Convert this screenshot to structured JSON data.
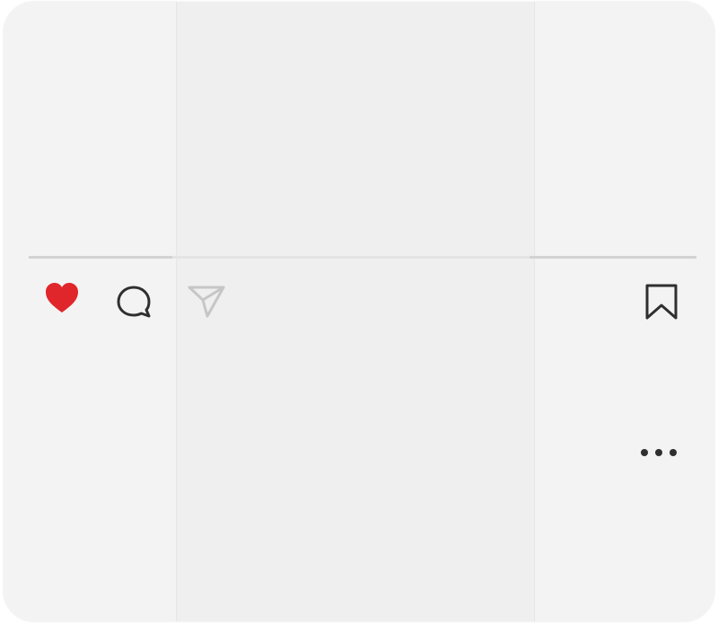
{
  "post": {
    "actions": {
      "like_icon": "heart-filled",
      "like_color": "#e0262b",
      "comment_icon": "speech-bubble",
      "share_icon": "paper-plane",
      "bookmark_icon": "bookmark"
    },
    "menu_icon": "more-horizontal"
  },
  "colors": {
    "card": "#f2f2f2",
    "icon_stroke": "#2f2f2f",
    "share_stroke": "#c6c6c6",
    "divider": "#d2d2d2"
  }
}
